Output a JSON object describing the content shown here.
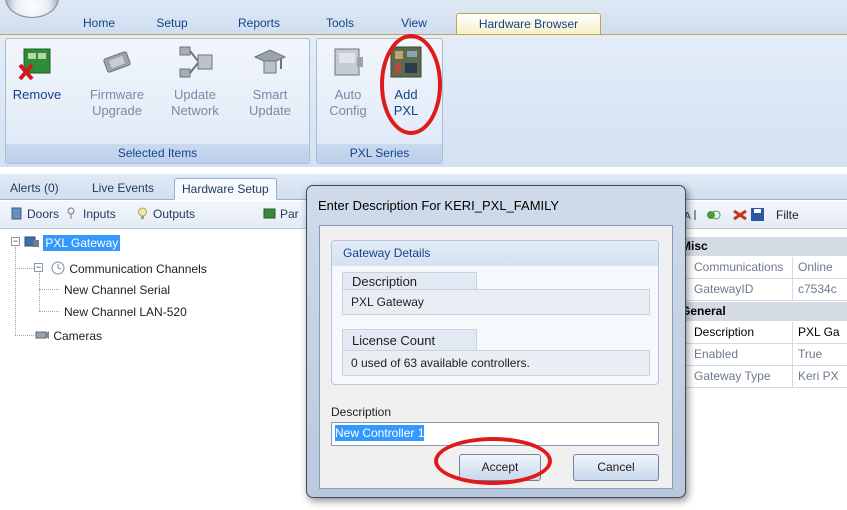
{
  "ribbon": {
    "tabs": [
      "Home",
      "Setup",
      "Reports",
      "Tools",
      "View",
      "Hardware Browser"
    ],
    "active_tab": "Hardware Browser",
    "groups": [
      {
        "title": "Selected Items",
        "buttons": [
          {
            "line1": "Remove",
            "line2": ""
          },
          {
            "line1": "Firmware",
            "line2": "Upgrade"
          },
          {
            "line1": "Update",
            "line2": "Network"
          },
          {
            "line1": "Smart",
            "line2": "Update"
          }
        ]
      },
      {
        "title": "PXL Series",
        "buttons": [
          {
            "line1": "Auto",
            "line2": "Config"
          },
          {
            "line1": "Add",
            "line2": "PXL"
          }
        ]
      }
    ]
  },
  "dock": {
    "tabs": [
      "Alerts (0)",
      "Live Events",
      "Hardware Setup"
    ],
    "active_tab": "Hardware Setup",
    "toolbar": [
      "Doors",
      "Inputs",
      "Outputs",
      "Par"
    ]
  },
  "tree": {
    "root": "PXL Gateway",
    "channels": "Communication Channels",
    "channel_items": [
      "New Channel Serial",
      "New Channel LAN-520"
    ],
    "cameras": "Cameras"
  },
  "property_grid": {
    "filter_label": "Filte",
    "categories": [
      {
        "name": "Misc",
        "rows": [
          {
            "key": "Communications",
            "value": "Online"
          },
          {
            "key": "GatewayID",
            "value": "c7534c"
          }
        ]
      },
      {
        "name": "General",
        "rows": [
          {
            "key": "Description",
            "value": "PXL Ga"
          },
          {
            "key": "Enabled",
            "value": "True"
          },
          {
            "key": "Gateway Type",
            "value": "Keri PX"
          }
        ]
      }
    ]
  },
  "dialog": {
    "title": "Enter Description For  KERI_PXL_FAMILY",
    "section_title": "Gateway Details",
    "description_label": "Description",
    "description_value": "PXL Gateway",
    "license_label": "License Count",
    "license_value": "0 used of 63 available controllers.",
    "input_label": "Description",
    "input_value": "New Controller 1",
    "accept_label": "Accept",
    "cancel_label": "Cancel"
  },
  "colors": {
    "highlight_circle": "#e01a1a",
    "selection": "#3399ff",
    "ribbon_text": "#15428b"
  }
}
